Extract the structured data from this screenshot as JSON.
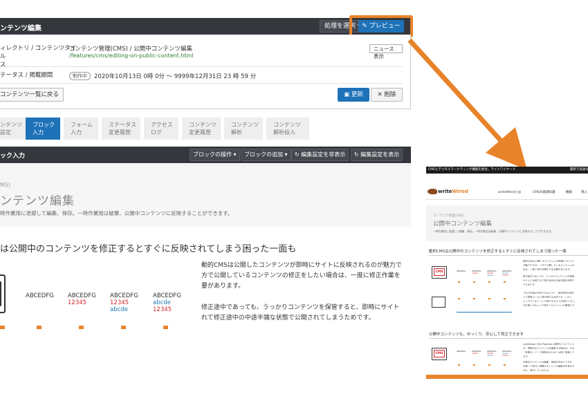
{
  "editor": {
    "title": "ンテンツ編集",
    "action_select": "処理を選択",
    "preview_button": "プレビュー",
    "directory_label_1": "ィレクトリ / コンテンツタイ",
    "directory_label_2": "ル",
    "directory_label_3": "ス",
    "content_path": "コンテンツ管理(CMS) / 公開中コンテンツ編集",
    "content_url": "/features/cms/editing-on-public-content.html",
    "news_button": "ニュース表示",
    "status_label": "テータス / 掲載期間",
    "status_badge": "制作中",
    "period": "2020年10月13日 0時 0分 〜 9999年12月31日 23 時 59 分",
    "back_button": "コンテンツ一覧に戻る",
    "update_button": "更新",
    "delete_button": "削除"
  },
  "tabs": [
    {
      "line1": "ンテンツ",
      "line2": "設定"
    },
    {
      "line1": "ブロック",
      "line2": "入力"
    },
    {
      "line1": "フォーム",
      "line2": "入力"
    },
    {
      "line1": "ステータス",
      "line2": "変更履歴"
    },
    {
      "line1": "アクセス",
      "line2": "ログ"
    },
    {
      "line1": "コンテンツ",
      "line2": "変更履歴"
    },
    {
      "line1": "コンテンツ",
      "line2": "解析"
    },
    {
      "line1": "コンテンツ",
      "line2": "解析投入"
    }
  ],
  "blockbar": {
    "title": "ック入力",
    "ops": "ブロックの操作",
    "add": "ブロックの追加",
    "hide": "編集設定を非表示",
    "show": "編集設定を表示"
  },
  "hero": {
    "small": "MS)",
    "title": "ンテンツ編集",
    "desc": "時作業用に退避して編集、保存。一時作業用は破棄、公開中コンテンツに反映することができます。"
  },
  "article": {
    "heading": "は公開中のコンテンツを修正するとすぐに反映されてしまう困った一面も",
    "col1": [
      "ABCEDFG"
    ],
    "col2": [
      "ABCEDFG",
      "12345"
    ],
    "col3": [
      "ABCEDFG",
      "12345",
      "abcde"
    ],
    "col4": [
      "ABCEDFG",
      "abcde",
      "12345"
    ],
    "para1": "動的CMSは公開したコンテンツが即時にサイトに反映されるのが魅力で\n方で公開しているコンテンツの修正をしたい場合は、一度に修正作業を\n要があります。",
    "para2": "修正途中であっても、うっかりコンテンツを保管すると、即時にサイト\nれて修正途中の中途半端な状態で公開されてしまうためです。"
  },
  "preview": {
    "topbar": "CMSとデジタルマーケティング機能を統合。ライトワイヤード",
    "topbar_right": "最新で高速なCMS",
    "brand_a": "write",
    "brand_b": "Wired",
    "nav": [
      "writeWiredとは",
      "CMSの基礎知識",
      "機能",
      "導入"
    ],
    "hero_small": "コンテンツ管理(CMS)",
    "hero_title": "公開中コンテンツ編集",
    "hero_desc": "一時作業用に退避して編集、保存。一時作業用は破棄、公開中コンテンツに反映することができます。",
    "section1": "動的CMSは公開中のコンテンツを修正するとすぐに反映されてしまう困った一面",
    "section2": "公開中コンテンツも、ゆっくり、安心して修正できます",
    "cms_label": "CMS",
    "text_lines_1": [
      "動的CMSは公開したコンテンツが即時にサイトに",
      "が魅力ですが、一方で公開しているコンテンツの",
      "合は、一度に修正作業をする必要があります。",
      "修正途中であっても、うっかりコンテンツを保管",
      "サイトに反映されて修正途中の中途半端な状態で",
      "うためです。",
      "ブログ記事のお知らせのように、誤字脱字の修正",
      "えて複数ページに渡る修正は大変です。しかし",
      "レイアウトをじっくり修正するような修正したい",
      "日を跨いでゆっくり修正したいといった要望にも"
    ],
    "text_lines_2": [
      "writeWired CMS Platform は動的にコンテンツ",
      "が、掲載中のコンテンツを編集する場合は、その",
      "「作業中」として複数中のものとは別に退避して",
      "ます。",
      "作業中コンテンツは編集、保管が自由にできる",
      "中断して翌日に再開するといった編集が出来ます",
      "のも、修正しているもの"
    ]
  },
  "colors": {
    "accent_orange": "#e8832a",
    "primary_blue": "#1e72b8",
    "dark_bar": "#34373c",
    "red": "#d8232a",
    "blue_text": "#1f77b4"
  }
}
